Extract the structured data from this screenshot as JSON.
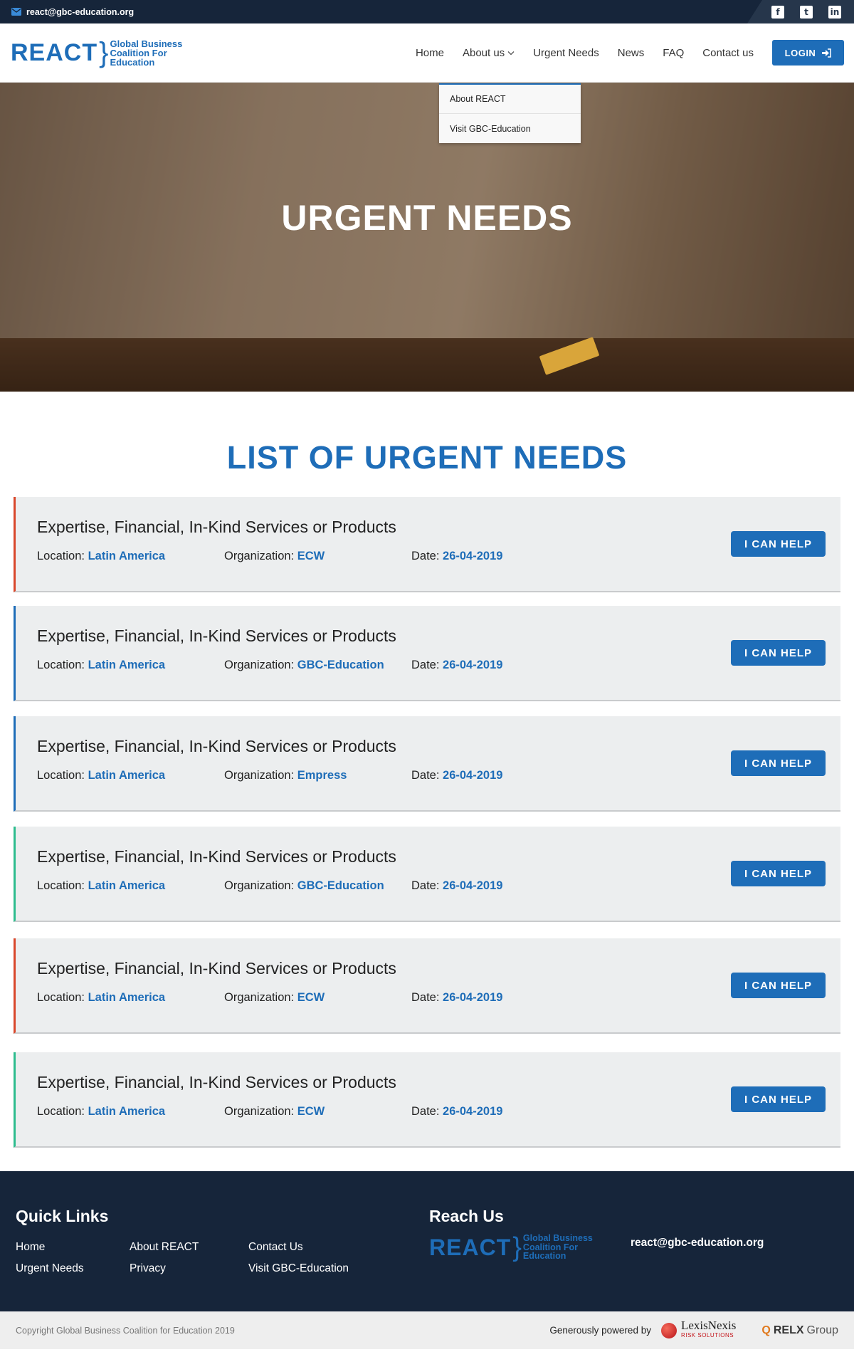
{
  "topbar": {
    "email": "react@gbc-education.org"
  },
  "social": {
    "facebook_icon": "f",
    "twitter_icon": "t",
    "linkedin_icon": "in"
  },
  "logo": {
    "name": "REACT",
    "sub1": "Global Business",
    "sub2": "Coalition For",
    "sub3": "Education"
  },
  "nav": {
    "home": "Home",
    "about": "About us",
    "urgent": "Urgent Needs",
    "news": "News",
    "faq": "FAQ",
    "contact": "Contact us",
    "login": "LOGIN"
  },
  "dropdown": [
    "About REACT",
    "Visit GBC-Education"
  ],
  "hero": {
    "title": "URGENT NEEDS"
  },
  "section": {
    "title": "LIST OF URGENT NEEDS"
  },
  "labels": {
    "location": "Location:",
    "organization": "Organization:",
    "date": "Date:",
    "button": "I CAN HELP"
  },
  "colors": {
    "red": "#d9472b",
    "blue": "#1e6db8",
    "teal": "#2dbc8e"
  },
  "needs": [
    {
      "title": "Expertise, Financial, In-Kind Services or Products",
      "location": "Latin America",
      "organization": "ECW",
      "date": "26-04-2019",
      "accent": "red"
    },
    {
      "title": "Expertise, Financial, In-Kind Services or Products",
      "location": "Latin America",
      "organization": "GBC-Education",
      "date": "26-04-2019",
      "accent": "blue"
    },
    {
      "title": "Expertise, Financial, In-Kind Services or Products",
      "location": "Latin America",
      "organization": "Empress",
      "date": "26-04-2019",
      "accent": "blue"
    },
    {
      "title": "Expertise, Financial, In-Kind Services or Products",
      "location": "Latin America",
      "organization": "GBC-Education",
      "date": "26-04-2019",
      "accent": "teal"
    },
    {
      "title": "Expertise, Financial, In-Kind Services or Products",
      "location": "Latin America",
      "organization": "ECW",
      "date": "26-04-2019",
      "accent": "red"
    },
    {
      "title": "Expertise, Financial, In-Kind Services or Products",
      "location": "Latin America",
      "organization": "ECW",
      "date": "26-04-2019",
      "accent": "teal"
    }
  ],
  "footer": {
    "quick_links_title": "Quick Links",
    "links": [
      "Home",
      "Urgent Needs",
      "About REACT",
      "Privacy",
      "Contact Us",
      "Visit GBC-Education"
    ],
    "reach_title": "Reach Us",
    "email": "react@gbc-education.org"
  },
  "bottom": {
    "copyright": "Copyright Global Business Coalition for Education 2019",
    "powered": "Generously powered by",
    "lexis": "LexisNexis",
    "lexis_sub": "RISK SOLUTIONS",
    "relx_a": "RELX",
    "relx_b": "Group"
  }
}
